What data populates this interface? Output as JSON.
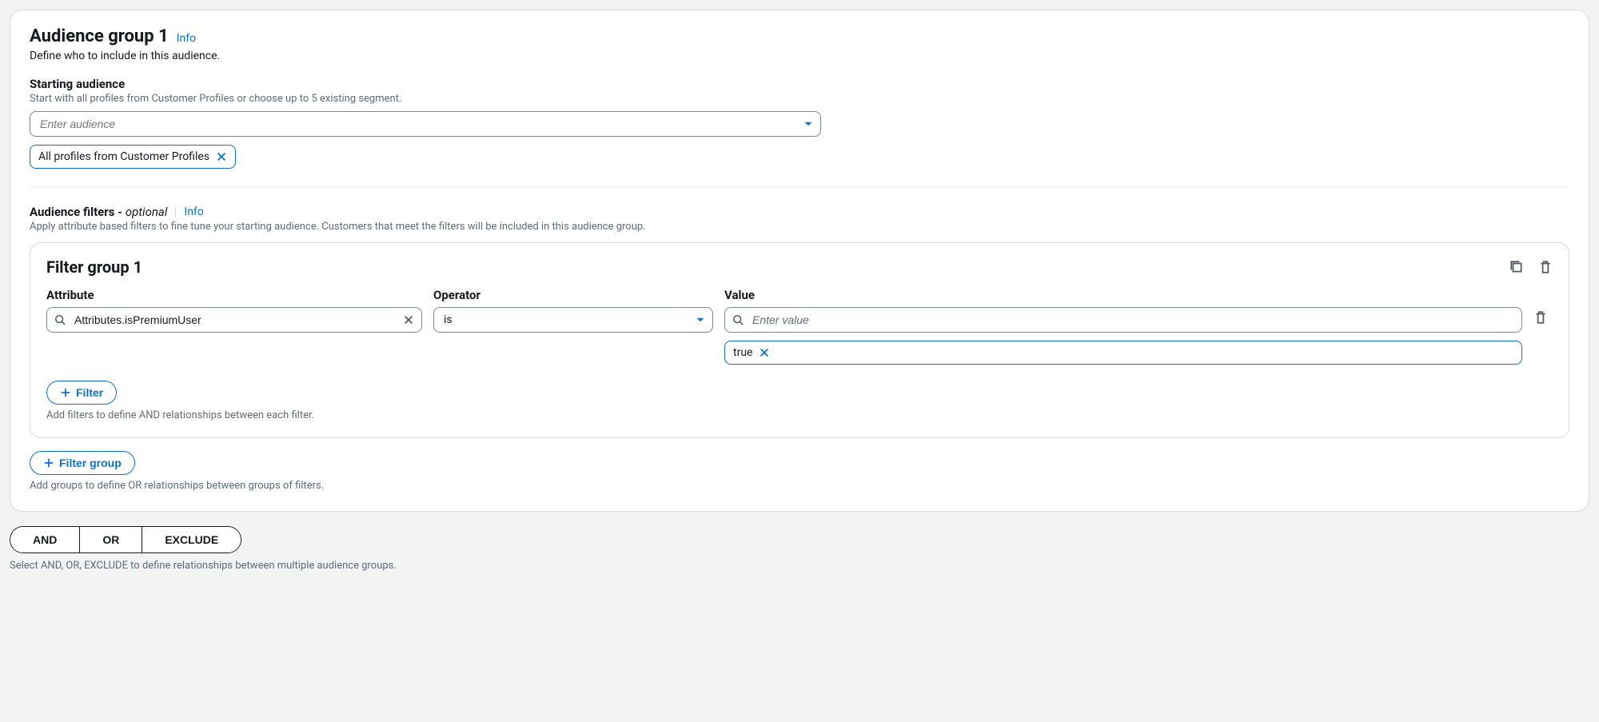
{
  "header": {
    "title": "Audience group 1",
    "info_label": "Info",
    "subheading": "Define who to include in this audience."
  },
  "starting_audience": {
    "label": "Starting audience",
    "hint": "Start with all profiles from Customer Profiles or choose up to 5 existing segment.",
    "placeholder": "Enter audience",
    "selected_token": "All profiles from Customer Profiles"
  },
  "audience_filters": {
    "label": "Audience filters - ",
    "optional": "optional",
    "info_label": "Info",
    "hint": "Apply attribute based filters to fine tune your starting audience. Customers that meet the filters will be included in this audience group."
  },
  "filter_group": {
    "title": "Filter group 1",
    "columns": {
      "attribute": "Attribute",
      "operator": "Operator",
      "value": "Value"
    },
    "row": {
      "attribute_value": "Attributes.isPremiumUser",
      "operator_value": "is",
      "value_placeholder": "Enter value",
      "value_token": "true"
    },
    "add_filter_label": "Filter",
    "add_filter_hint": "Add filters to define AND relationships between each filter."
  },
  "add_group": {
    "label": "Filter group",
    "hint": "Add groups to define OR relationships between groups of filters."
  },
  "relationship": {
    "options": [
      "AND",
      "OR",
      "EXCLUDE"
    ],
    "hint": "Select AND, OR, EXCLUDE to define relationships between multiple audience groups."
  }
}
